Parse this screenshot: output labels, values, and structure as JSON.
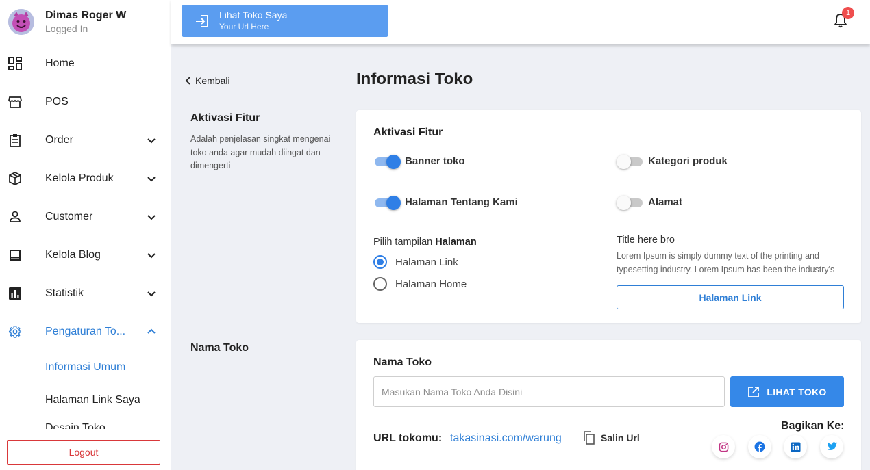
{
  "user": {
    "name": "Dimas Roger W",
    "status": "Logged In"
  },
  "sidebar": {
    "items": [
      {
        "label": "Home",
        "icon": "dashboard-icon",
        "expandable": false
      },
      {
        "label": "POS",
        "icon": "store-icon",
        "expandable": false
      },
      {
        "label": "Order",
        "icon": "clipboard-icon",
        "expandable": true
      },
      {
        "label": "Kelola Produk",
        "icon": "box-icon",
        "expandable": true
      },
      {
        "label": "Customer",
        "icon": "person-icon",
        "expandable": true
      },
      {
        "label": "Kelola Blog",
        "icon": "blog-icon",
        "expandable": true
      },
      {
        "label": "Statistik",
        "icon": "chart-icon",
        "expandable": true
      },
      {
        "label": "Pengaturan To...",
        "icon": "gear-icon",
        "expandable": true,
        "active": true,
        "expanded": true
      }
    ],
    "subitems": [
      {
        "label": "Informasi Umum",
        "active": true
      },
      {
        "label": "Halaman Link Saya",
        "active": false
      },
      {
        "label": "Desain Toko",
        "active": false
      }
    ],
    "logout_label": "Logout"
  },
  "topbar": {
    "store_button": {
      "title": "Lihat Toko Saya",
      "subtitle": "Your Url Here"
    },
    "notification_count": "1"
  },
  "main": {
    "back_label": "Kembali",
    "page_title": "Informasi Toko",
    "section_feature": {
      "side_title": "Aktivasi Fitur",
      "side_description": "Adalah penjelasan singkat mengenai toko anda agar mudah diingat dan dimengerti",
      "card_title": "Aktivasi Fitur",
      "toggles": [
        {
          "label": "Banner toko",
          "on": true
        },
        {
          "label": "Kategori produk",
          "on": false
        },
        {
          "label": "Halaman Tentang Kami",
          "on": true
        },
        {
          "label": "Alamat",
          "on": false
        }
      ],
      "choose_label_prefix": "Pilih tampilan",
      "choose_label_bold": "Halaman",
      "radio_options": [
        {
          "label": "Halaman Link",
          "checked": true
        },
        {
          "label": "Halaman Home",
          "checked": false
        }
      ],
      "info_title": "Title here bro",
      "info_text": "Lorem Ipsum is simply dummy text of the printing and typesetting industry. Lorem Ipsum has been the industry's",
      "link_button": "Halaman Link"
    },
    "section_name": {
      "side_title": "Nama Toko",
      "card_title": "Nama Toko",
      "input_placeholder": "Masukan Nama Toko Anda Disini",
      "input_value": "",
      "see_button": "LIHAT TOKO",
      "url_label": "URL tokomu:",
      "url_value": "takasinasi.com/warung",
      "copy_label": "Salin Url",
      "share_label": "Bagikan Ke:",
      "share_icons": [
        "instagram-icon",
        "facebook-icon",
        "linkedin-icon",
        "twitter-icon"
      ]
    }
  },
  "colors": {
    "accent": "#2f7fe6",
    "link": "#2f7fd6",
    "store_button": "#5b9df0",
    "danger": "#d9383a",
    "badge": "#ef4e4e",
    "background": "#eef0f5"
  }
}
